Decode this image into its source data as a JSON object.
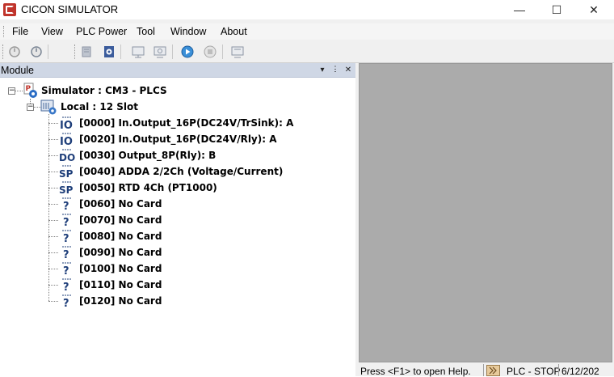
{
  "window": {
    "title": "CICON SIMULATOR",
    "minimize": "—",
    "maximize": "☐",
    "close": "✕"
  },
  "menu": {
    "items": [
      "File",
      "View",
      "PLC Power",
      "Tool",
      "Window",
      "About"
    ]
  },
  "toolbar": {
    "buttons": [
      "power-off",
      "power-on",
      "io-module",
      "settings",
      "monitor",
      "monitor-refresh",
      "run",
      "stop",
      "display"
    ]
  },
  "module_panel": {
    "title": "Module",
    "dropdown": "▾",
    "pin": "ⵗ",
    "close": "✕"
  },
  "tree": {
    "root": "Simulator : CM3 - PLCS",
    "local": "Local : 12 Slot",
    "slots": [
      {
        "icon": "IO",
        "label": "[0000] In.Output_16P(DC24V/TrSink): A"
      },
      {
        "icon": "IO",
        "label": "[0020] In.Output_16P(DC24V/Rly): A"
      },
      {
        "icon": "DO",
        "label": "[0030] Output_8P(Rly): B"
      },
      {
        "icon": "SP",
        "label": "[0040] ADDA 2/2Ch (Voltage/Current)"
      },
      {
        "icon": "SP",
        "label": "[0050] RTD 4Ch (PT1000)"
      },
      {
        "icon": "?",
        "label": "[0060] No Card"
      },
      {
        "icon": "?",
        "label": "[0070] No Card"
      },
      {
        "icon": "?",
        "label": "[0080] No Card"
      },
      {
        "icon": "?",
        "label": "[0090] No Card"
      },
      {
        "icon": "?",
        "label": "[0100] No Card"
      },
      {
        "icon": "?",
        "label": "[0110] No Card"
      },
      {
        "icon": "?",
        "label": "[0120] No Card"
      }
    ]
  },
  "status": {
    "help": "Press <F1> to open Help.",
    "plc": "PLC - STOP",
    "date": "6/12/202"
  },
  "colors": {
    "panel_header": "#cfd7e5",
    "workspace": "#ababab",
    "app_icon": "#c0342b",
    "io_icon": "#1f3f7a"
  }
}
